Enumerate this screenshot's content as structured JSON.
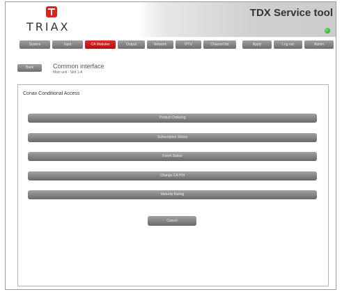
{
  "brand": {
    "logo_text": "TRIAX"
  },
  "header": {
    "app_title": "TDX Service tool",
    "status_color": "#22b022"
  },
  "nav": {
    "tabs": [
      {
        "label": "System"
      },
      {
        "label": "Input"
      },
      {
        "label": "CA Modules",
        "active": true
      },
      {
        "label": "Output"
      },
      {
        "label": "Network"
      },
      {
        "label": "IPTV"
      },
      {
        "label": "Channel list"
      }
    ],
    "actions": [
      {
        "label": "Apply"
      },
      {
        "label": "Log out"
      },
      {
        "label": "Admin"
      }
    ]
  },
  "page": {
    "back_label": "Back",
    "title": "Common interface",
    "subtitle": "Main unit - Slot 1-A"
  },
  "panel": {
    "title": "Conax Conditional Access",
    "buttons": [
      {
        "label": "Product Ordering"
      },
      {
        "label": "Subscription Status"
      },
      {
        "label": "Event Status"
      },
      {
        "label": "Change CA PIN"
      },
      {
        "label": "Maturity Rating"
      }
    ],
    "cancel_label": "Cancel"
  },
  "colors": {
    "accent": "#d11a1a",
    "button_gray": "#888888",
    "panel_border": "#b5b5b5"
  }
}
